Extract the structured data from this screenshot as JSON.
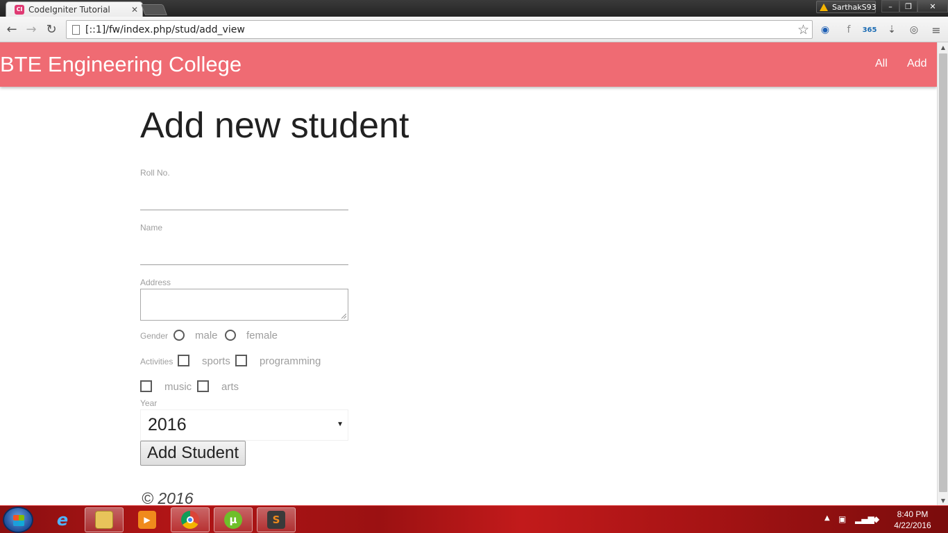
{
  "browser": {
    "tab_title": "CodeIgniter Tutorial",
    "profile_name": "SarthakS93",
    "url": "[::1]/fw/index.php/stud/add_view",
    "window_buttons": [
      "–",
      "❐",
      "✕"
    ]
  },
  "navbar": {
    "brand": "BTE Engineering College",
    "links": [
      {
        "label": "All"
      },
      {
        "label": "Add"
      }
    ],
    "color": "#ef6b73"
  },
  "page": {
    "title": "Add new student",
    "form": {
      "roll_label": "Roll No.",
      "roll_value": "",
      "name_label": "Name",
      "name_value": "",
      "address_label": "Address",
      "address_value": "",
      "gender_label": "Gender",
      "gender_options": [
        "male",
        "female"
      ],
      "activities_label": "Activities",
      "activities_options": [
        "sports",
        "programming",
        "music",
        "arts"
      ],
      "year_label": "Year",
      "year_value": "2016",
      "submit_label": "Add Student"
    },
    "footer": "© 2016"
  },
  "taskbar": {
    "clock_time": "8:40 PM",
    "clock_date": "4/22/2016",
    "apps": [
      "internet-explorer",
      "file-explorer",
      "media-player",
      "chrome",
      "utorrent",
      "sublime-text"
    ]
  }
}
